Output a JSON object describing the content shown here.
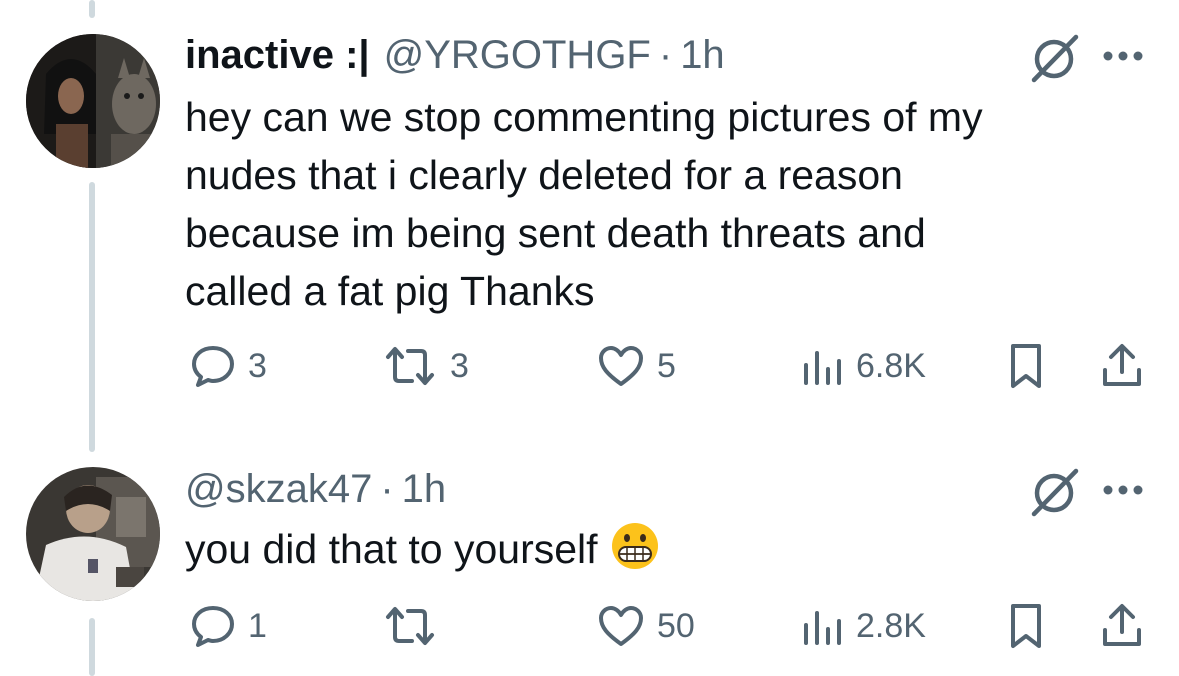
{
  "tweets": [
    {
      "display_name": "inactive :|",
      "handle": "@YRGOTHGF",
      "separator": "·",
      "time": "1h",
      "lines": [
        "hey can we stop commenting pictures of my",
        "nudes that i clearly deleted for a reason",
        "because im being sent death threats and",
        "called a fat pig Thanks"
      ],
      "replies": "3",
      "reposts": "3",
      "likes": "5",
      "views": "6.8K"
    },
    {
      "handle": "@skzak47",
      "separator": "·",
      "time": "1h",
      "text": "you did that to yourself",
      "emoji": "grimacing-face",
      "replies": "1",
      "reposts": "",
      "likes": "50",
      "views": "2.8K"
    }
  ],
  "icons": {
    "grok": "grok-icon",
    "more": "more-icon",
    "reply": "reply-icon",
    "repost": "repost-icon",
    "like": "heart-icon",
    "views": "views-icon",
    "bookmark": "bookmark-icon",
    "share": "share-icon"
  },
  "colors": {
    "text": "#0f1419",
    "secondary": "#536471",
    "thread_line": "#cfd9de",
    "icon_gray": "#536471"
  }
}
